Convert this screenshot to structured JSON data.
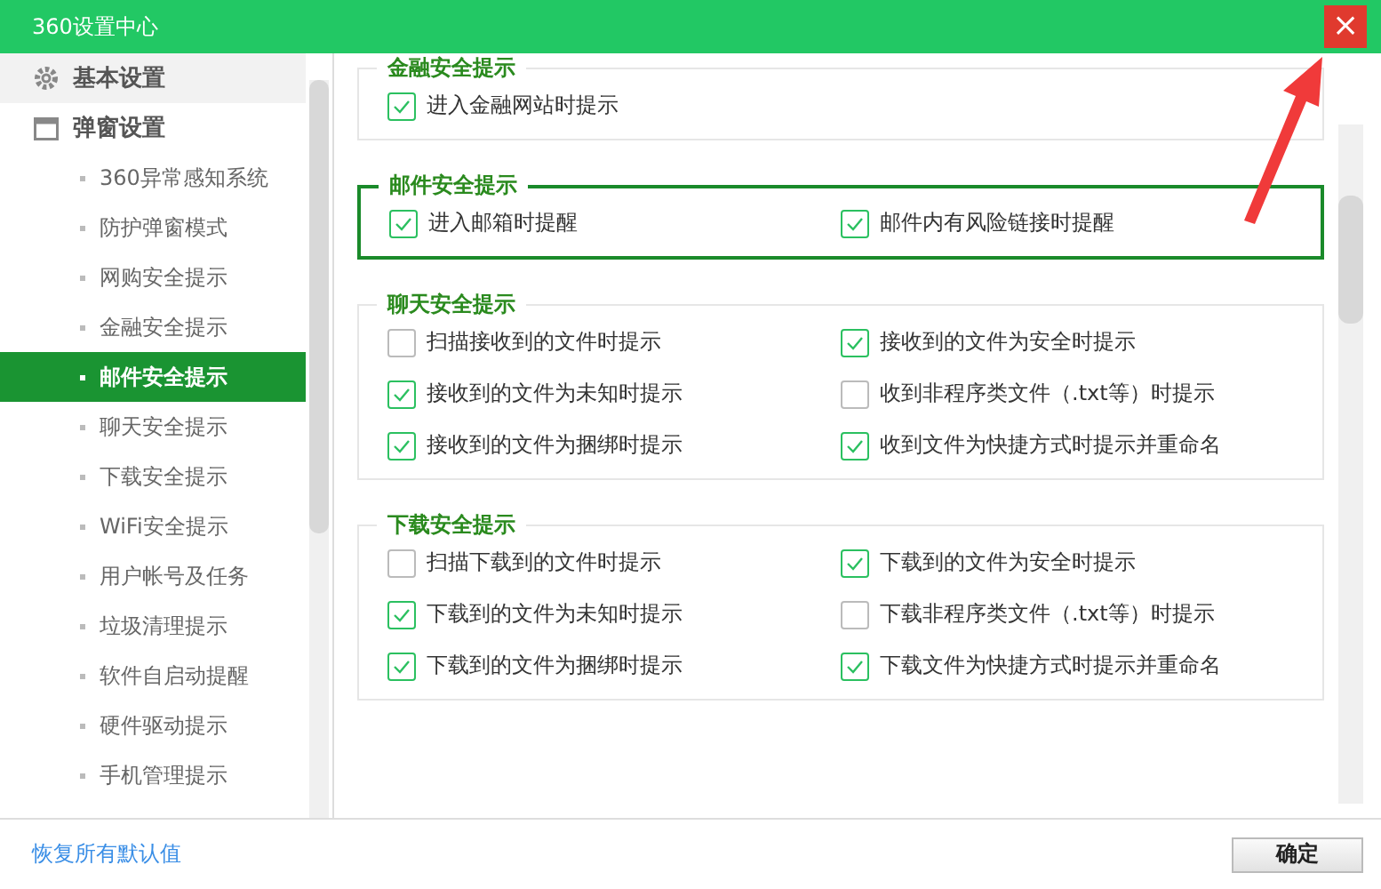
{
  "window": {
    "title": "360设置中心",
    "close": "×"
  },
  "sidebar": {
    "items": [
      {
        "kind": "group",
        "label": "基本设置",
        "selected": false
      },
      {
        "kind": "group",
        "label": "弹窗设置",
        "selected": false
      },
      {
        "kind": "item",
        "label": "360异常感知系统",
        "selected": false
      },
      {
        "kind": "item",
        "label": "防护弹窗模式",
        "selected": false
      },
      {
        "kind": "item",
        "label": "网购安全提示",
        "selected": false
      },
      {
        "kind": "item",
        "label": "金融安全提示",
        "selected": false
      },
      {
        "kind": "item",
        "label": "邮件安全提示",
        "selected": true
      },
      {
        "kind": "item",
        "label": "聊天安全提示",
        "selected": false
      },
      {
        "kind": "item",
        "label": "下载安全提示",
        "selected": false
      },
      {
        "kind": "item",
        "label": "WiFi安全提示",
        "selected": false
      },
      {
        "kind": "item",
        "label": "用户帐号及任务",
        "selected": false
      },
      {
        "kind": "item",
        "label": "垃圾清理提示",
        "selected": false
      },
      {
        "kind": "item",
        "label": "软件自启动提醒",
        "selected": false
      },
      {
        "kind": "item",
        "label": "硬件驱动提示",
        "selected": false
      },
      {
        "kind": "item",
        "label": "手机管理提示",
        "selected": false
      }
    ]
  },
  "sections": [
    {
      "title": "金融安全提示",
      "highlighted": false,
      "options": [
        {
          "label": "进入金融网站时提示",
          "checked": true
        }
      ]
    },
    {
      "title": "邮件安全提示",
      "highlighted": true,
      "options": [
        {
          "label": "进入邮箱时提醒",
          "checked": true
        },
        {
          "label": "邮件内有风险链接时提醒",
          "checked": true
        }
      ]
    },
    {
      "title": "聊天安全提示",
      "highlighted": false,
      "options": [
        {
          "label": "扫描接收到的文件时提示",
          "checked": false
        },
        {
          "label": "接收到的文件为安全时提示",
          "checked": true
        },
        {
          "label": "接收到的文件为未知时提示",
          "checked": true
        },
        {
          "label": "收到非程序类文件（.txt等）时提示",
          "checked": false
        },
        {
          "label": "接收到的文件为捆绑时提示",
          "checked": true
        },
        {
          "label": "收到文件为快捷方式时提示并重命名",
          "checked": true
        }
      ]
    },
    {
      "title": "下载安全提示",
      "highlighted": false,
      "options": [
        {
          "label": "扫描下载到的文件时提示",
          "checked": false
        },
        {
          "label": "下载到的文件为安全时提示",
          "checked": true
        },
        {
          "label": "下载到的文件为未知时提示",
          "checked": true
        },
        {
          "label": "下载非程序类文件（.txt等）时提示",
          "checked": false
        },
        {
          "label": "下载到的文件为捆绑时提示",
          "checked": true
        },
        {
          "label": "下载文件为快捷方式时提示并重命名",
          "checked": true
        }
      ]
    }
  ],
  "footer": {
    "restore_link": "恢复所有默认值",
    "ok_button": "确定"
  }
}
